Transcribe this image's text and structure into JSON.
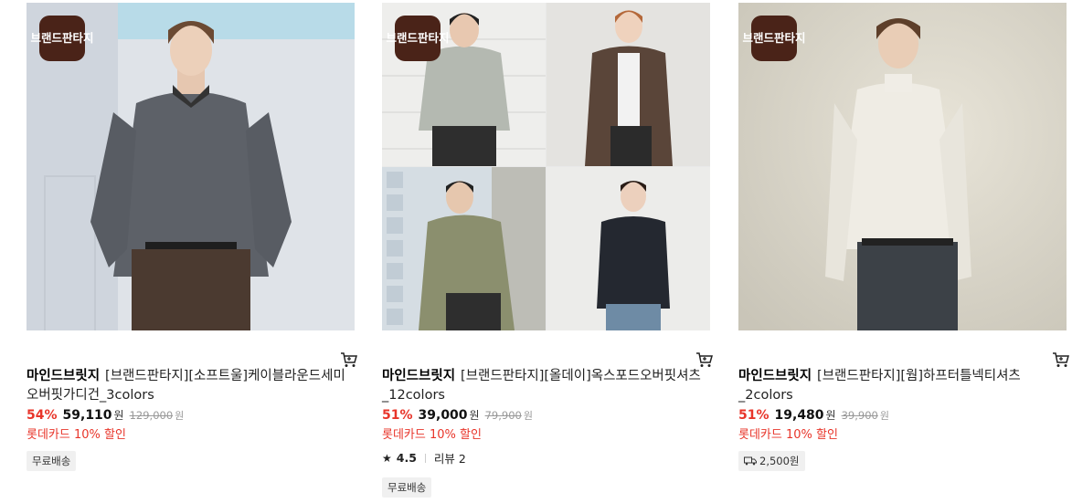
{
  "badge_label": "브랜드판타지",
  "products": [
    {
      "brand": "마인드브릿지",
      "name": "[브랜드판타지][소프트울]케이블라운드세미오버핏가디건_3colors",
      "discount": "54%",
      "price": "59,110",
      "currency": "원",
      "original_price": "129,000",
      "card_promo": "롯데카드 10% 할인",
      "shipping": "무료배송"
    },
    {
      "brand": "마인드브릿지",
      "name": "[브랜드판타지][올데이]옥스포드오버핏셔츠_12colors",
      "discount": "51%",
      "price": "39,000",
      "currency": "원",
      "original_price": "79,900",
      "card_promo": "롯데카드 10% 할인",
      "rating": "4.5",
      "review_label": "리뷰 2",
      "shipping": "무료배송"
    },
    {
      "brand": "마인드브릿지",
      "name": "[브랜드판타지][웜]하프터틀넥티셔츠_2colors",
      "discount": "51%",
      "price": "19,480",
      "currency": "원",
      "original_price": "39,900",
      "card_promo": "롯데카드 10% 할인",
      "shipping": "2,500원"
    }
  ],
  "icons": {
    "cart": "cart-icon",
    "star": "star-icon",
    "truck": "truck-icon"
  }
}
